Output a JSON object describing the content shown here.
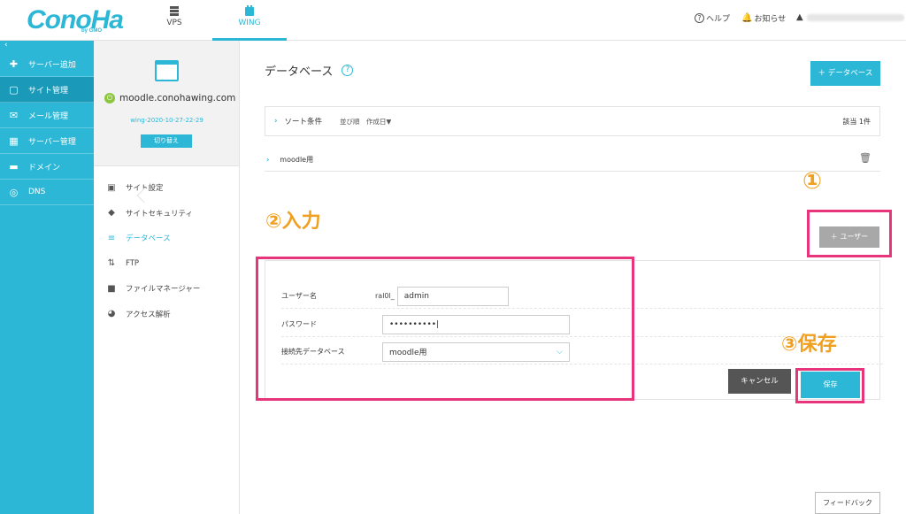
{
  "brand": {
    "logo": "ConoHa",
    "sub": "by GMO"
  },
  "topnav": {
    "tabs": [
      {
        "label": "VPS"
      },
      {
        "label": "WING"
      }
    ],
    "help": "ヘルプ",
    "notice": "お知らせ"
  },
  "sidebar": {
    "items": [
      {
        "label": "サーバー追加",
        "icon": "plus-icon"
      },
      {
        "label": "サイト管理",
        "icon": "window-icon"
      },
      {
        "label": "メール管理",
        "icon": "mail-icon"
      },
      {
        "label": "サーバー管理",
        "icon": "server-icon"
      },
      {
        "label": "ドメイン",
        "icon": "domain-icon"
      },
      {
        "label": "DNS",
        "icon": "globe-icon"
      }
    ]
  },
  "site_panel": {
    "domain": "moodle.conohawing.com",
    "wing_id": "wing-2020-10-27-22-29",
    "switch_label": "切り替え",
    "menu": [
      {
        "label": "サイト設定"
      },
      {
        "label": "サイトセキュリティ"
      },
      {
        "label": "データベース"
      },
      {
        "label": "FTP"
      },
      {
        "label": "ファイルマネージャー"
      },
      {
        "label": "アクセス解析"
      }
    ]
  },
  "main": {
    "title": "データベース",
    "add_db_label": "＋ データベース",
    "sort_label": "ソート条件",
    "sort_by": "並び順　作成日▼",
    "count": "該当 1件",
    "db_name": "moodle用",
    "add_user_label": "＋ ユーザー",
    "form": {
      "username_label": "ユーザー名",
      "username_prefix": "ral0l_",
      "username_value": "admin",
      "password_label": "パスワード",
      "password_value": "••••••••••|",
      "db_label": "接続先データベース",
      "db_value": "moodle用"
    },
    "cancel_label": "キャンセル",
    "save_label": "保存",
    "feedback_label": "フィードバック"
  },
  "annotations": {
    "one": "①",
    "two": "②入力",
    "three": "③保存"
  },
  "colors": {
    "accent": "#2cb7d6",
    "highlight": "#e8347a",
    "annotation": "#f0a020"
  }
}
